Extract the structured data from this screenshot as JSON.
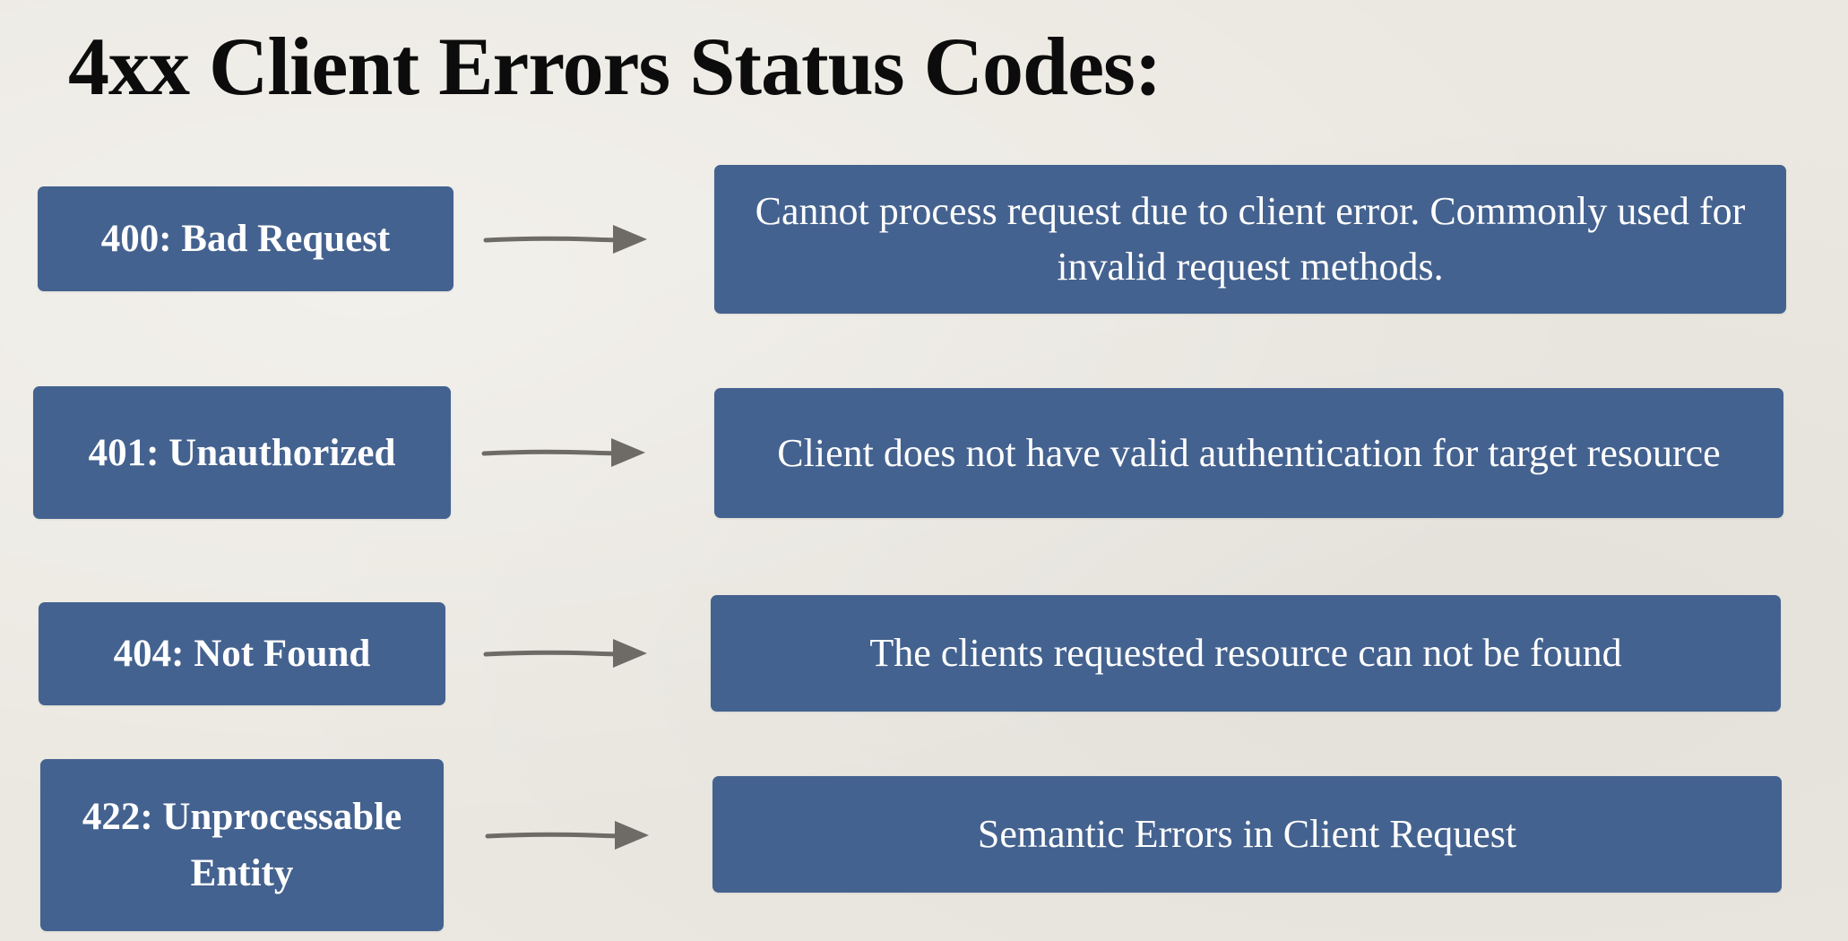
{
  "title": "4xx Client Errors Status Codes:",
  "rows": [
    {
      "code": "400: Bad Request",
      "description": "Cannot process request due to client error. Commonly used for invalid request methods."
    },
    {
      "code": "401: Unauthorized",
      "description": "Client does not have valid authentication for target resource"
    },
    {
      "code": "404: Not Found",
      "description": "The clients requested resource can not be found"
    },
    {
      "code": "422: Unprocessable Entity",
      "description": "Semantic Errors in Client Request"
    }
  ],
  "colors": {
    "background": "#ebe8e1",
    "box": "#44628f",
    "box_text": "#ffffff",
    "title_text": "#0c0c0c",
    "arrow": "#6e6b66"
  },
  "icons": {
    "connector": "right-arrow-icon"
  }
}
